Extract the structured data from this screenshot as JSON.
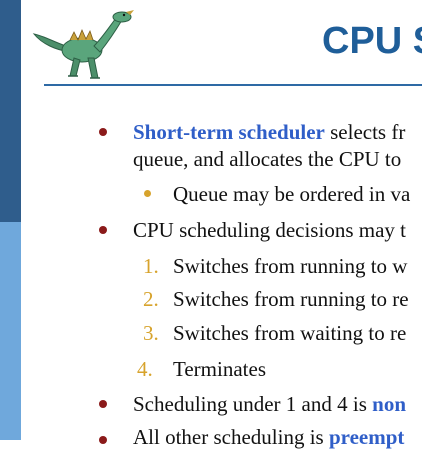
{
  "slide": {
    "title": "CPU S",
    "bullets": {
      "b1_term": "Short-term scheduler",
      "b1_rest": " selects fr",
      "b1_cont": "queue, and allocates the CPU to",
      "b1_sub": "Queue may be ordered in va",
      "b2": "CPU scheduling decisions may t",
      "items": [
        {
          "num": "1.",
          "text": "Switches from running to w"
        },
        {
          "num": "2.",
          "text": "Switches from running to re"
        },
        {
          "num": "3.",
          "text": "Switches from waiting to re"
        },
        {
          "num": "4.",
          "text": "Terminates"
        }
      ],
      "b3_pre": "Scheduling under 1 and 4 is ",
      "b3_term": "non",
      "b4_pre": "All other scheduling is ",
      "b4_term": "preempt"
    }
  },
  "colors": {
    "accent": "#1f5e99",
    "bullet": "#8b1a1a",
    "sub_bullet": "#d7a32c",
    "keyword": "#2f5ec8"
  }
}
